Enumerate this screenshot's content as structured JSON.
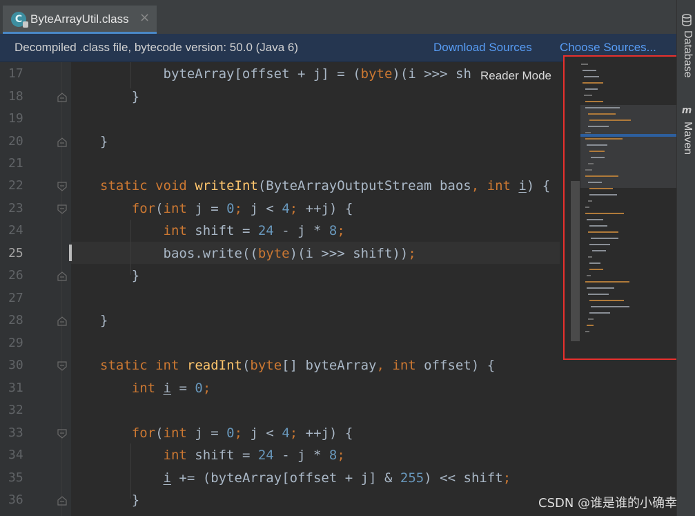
{
  "tab": {
    "icon": "java-class-icon",
    "icon_letter": "C",
    "title": "ByteArrayUtil.class",
    "close": "×"
  },
  "banner": {
    "text": "Decompiled .class file, bytecode version: 50.0 (Java 6)",
    "download_sources": "Download Sources",
    "choose_sources": "Choose Sources..."
  },
  "editor": {
    "reader_mode": "Reader Mode",
    "current_line": 25,
    "lines": [
      {
        "number": "17",
        "code": "        byteArray[offset + j] = (byte)(i >>> sh"
      },
      {
        "number": "18",
        "code": "    }"
      },
      {
        "number": "19",
        "code": ""
      },
      {
        "number": "20",
        "code": "}"
      },
      {
        "number": "21",
        "code": ""
      },
      {
        "number": "22",
        "code": "static void writeInt(ByteArrayOutputStream baos, int i) {"
      },
      {
        "number": "23",
        "code": "    for(int j = 0; j < 4; ++j) {"
      },
      {
        "number": "24",
        "code": "        int shift = 24 - j * 8;"
      },
      {
        "number": "25",
        "code": "        baos.write((byte)(i >>> shift));"
      },
      {
        "number": "26",
        "code": "    }"
      },
      {
        "number": "27",
        "code": ""
      },
      {
        "number": "28",
        "code": "}"
      },
      {
        "number": "29",
        "code": ""
      },
      {
        "number": "30",
        "code": "static int readInt(byte[] byteArray, int offset) {"
      },
      {
        "number": "31",
        "code": "    int i = 0;"
      },
      {
        "number": "32",
        "code": ""
      },
      {
        "number": "33",
        "code": "    for(int j = 0; j < 4; ++j) {"
      },
      {
        "number": "34",
        "code": "        int shift = 24 - j * 8;"
      },
      {
        "number": "35",
        "code": "        i += (byteArray[offset + j] & 255) << shift;"
      },
      {
        "number": "36",
        "code": "    }"
      }
    ]
  },
  "right_toolbar": {
    "database_label": "Database",
    "database_icon": "database-icon",
    "maven_label": "Maven",
    "maven_icon": "maven-icon",
    "maven_icon_glyph": "m"
  },
  "watermark": "CSDN @谁是谁的小确幸",
  "colors": {
    "keyword": "#cc7832",
    "function": "#ffc66d",
    "number": "#6897bb",
    "plain": "#a9b7c6",
    "link": "#589df6",
    "annotation": "#e8302d"
  }
}
